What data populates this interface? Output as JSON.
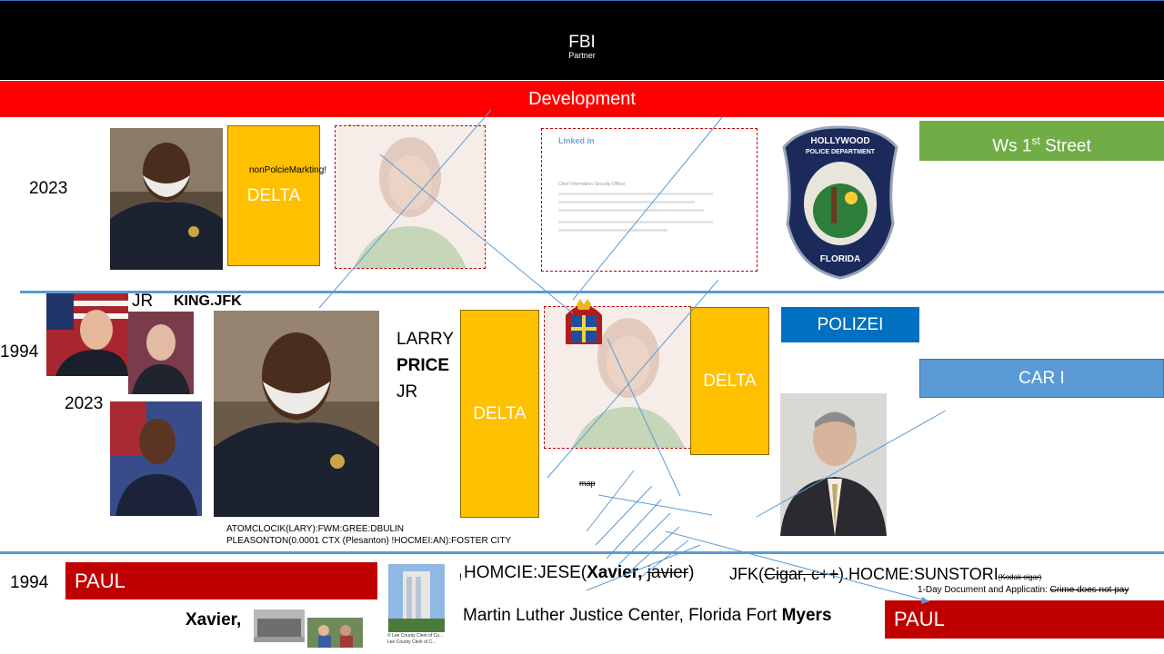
{
  "header": {
    "title": "FBI",
    "subtitle": "Partner"
  },
  "dev_bar": {
    "label": "Development"
  },
  "years": {
    "y2023_top": "2023",
    "y1994_mid": "1994",
    "y2023_mid": "2023",
    "y1994_bottom": "1994"
  },
  "boxes": {
    "delta_top": "DELTA",
    "delta_mid_left": "DELTA",
    "delta_mid_right": "DELTA",
    "ws_street_main": "Ws 1",
    "ws_street_sup": "st",
    "ws_street_tail": " Street",
    "polizei": "POLIZEI",
    "car": "CAR I",
    "paul_left": "PAUL",
    "paul_right": "PAUL"
  },
  "labels": {
    "nonpolice": "nonPolcieMarkting!",
    "jr_top": "JR",
    "king_jfk": "KING.JFK",
    "larry": "LARRY",
    "price": "PRICE",
    "jr_mid": "JR",
    "atom_line1": "ATOMCLOCIK(LARY):FWM:GREE:DBULIN",
    "atom_line2": "PLEASONTON(0.0001 CTX (Plesanton) !HOCMEI:AN):FOSTER CITY",
    "map": "map",
    "xavier": "Xavier,",
    "homcie_prefix": "HOMCIE:JESE(",
    "homcie_bold": "Xavier,",
    "homcie_strike": "javier",
    "homcie_suffix": ")",
    "exclaim": "!",
    "jfk_prefix": "JFK(",
    "jfk_strike": "Cigar, c++",
    "jfk_suffix": ").HOCME:SUNSTORI",
    "jfk_small_strike": "(Kodak cigar)",
    "oneday_prefix": "1-Day Document and Applicatin: ",
    "oneday_strike": "Crime does not pay",
    "mlk_main": "Martin Luther Justice Center, Florida Fort ",
    "mlk_bold": "Myers",
    "lee_caption1": "© Lee County Clerk of Co...",
    "lee_caption2": "Lee County Clerk of C..."
  },
  "linkedin": {
    "brand": "Linked in",
    "title": "Chief Information Security Officer"
  },
  "badge": {
    "top": "HOLLYWOOD",
    "mid": "POLICE DEPARTMENT",
    "bottom": "FLORIDA"
  },
  "colors": {
    "black_bar": "#000000",
    "red_bar": "#ff0000",
    "gold": "#ffc000",
    "green": "#70ad47",
    "polizei_blue": "#0070c0",
    "car_blue": "#5b9bd5",
    "dark_red": "#c00000",
    "divider": "#5b9bd5"
  }
}
